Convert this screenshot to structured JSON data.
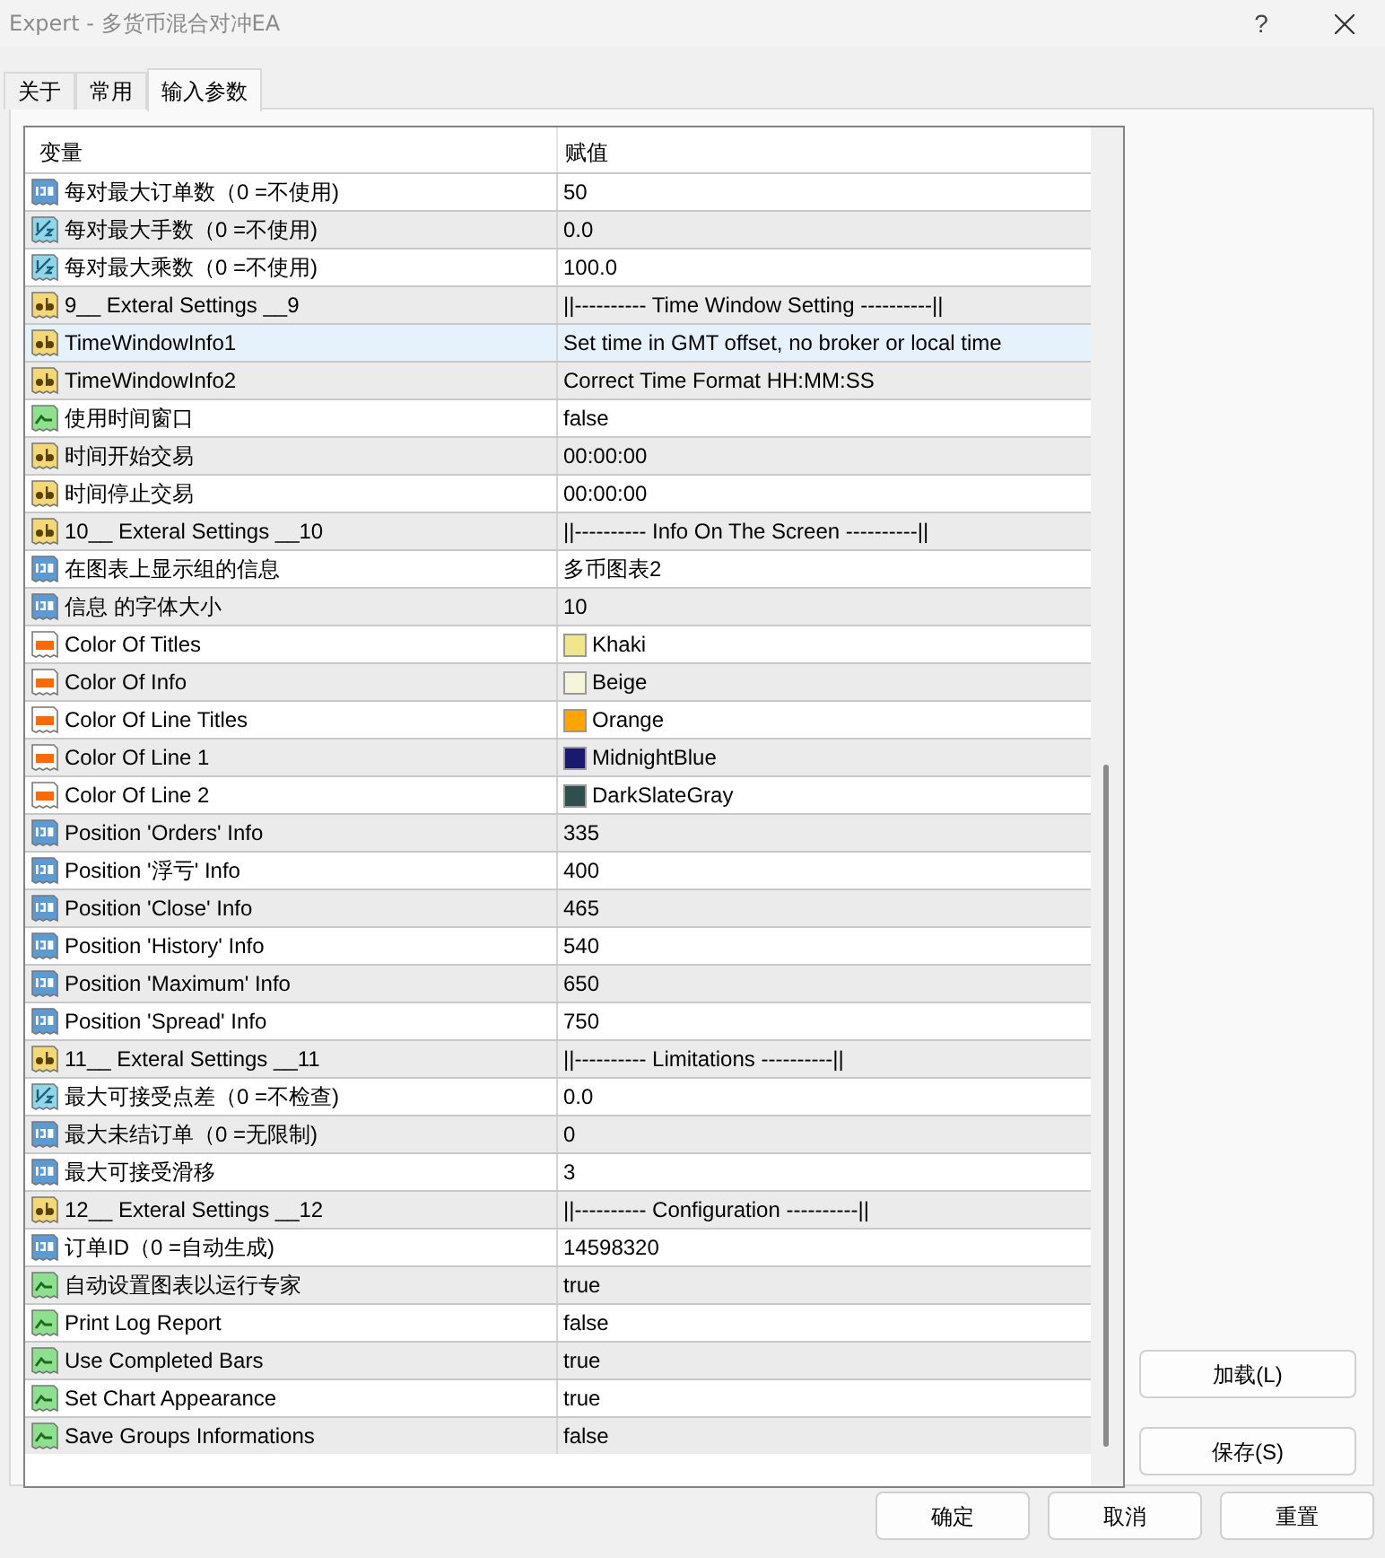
{
  "window": {
    "title": "Expert - 多货币混合对冲EA",
    "help": "?"
  },
  "tabs": [
    {
      "label": "关于",
      "selected": false
    },
    {
      "label": "常用",
      "selected": false
    },
    {
      "label": "输入参数",
      "selected": true
    }
  ],
  "table": {
    "columns": [
      "变量",
      "赋值"
    ],
    "rows": [
      {
        "kind": "int",
        "name": "每对最大订单数（0 =不使用)",
        "value": "50",
        "selected": false
      },
      {
        "kind": "double",
        "name": "每对最大手数（0 =不使用)",
        "value": "0.0",
        "selected": false
      },
      {
        "kind": "double",
        "name": "每对最大乘数（0 =不使用)",
        "value": "100.0",
        "selected": false
      },
      {
        "kind": "string",
        "name": "9__ Exteral Settings __9",
        "value": "||---------- Time Window Setting ----------||",
        "selected": false
      },
      {
        "kind": "string",
        "name": "TimeWindowInfo1",
        "value": "Set time in GMT offset, no broker or local time",
        "selected": true
      },
      {
        "kind": "string",
        "name": "TimeWindowInfo2",
        "value": "Correct Time Format HH:MM:SS",
        "selected": false
      },
      {
        "kind": "bool",
        "name": "使用时间窗口",
        "value": "false",
        "selected": false
      },
      {
        "kind": "string",
        "name": "时间开始交易",
        "value": "00:00:00",
        "selected": false
      },
      {
        "kind": "string",
        "name": "时间停止交易",
        "value": "00:00:00",
        "selected": false
      },
      {
        "kind": "string",
        "name": "10__ Exteral Settings __10",
        "value": "||---------- Info On The Screen ----------||",
        "selected": false
      },
      {
        "kind": "int",
        "name": "在图表上显示组的信息",
        "value": "多币图表2",
        "selected": false
      },
      {
        "kind": "int",
        "name": "信息 的字体大小",
        "value": "10",
        "selected": false
      },
      {
        "kind": "color",
        "name": "Color Of Titles",
        "value": "Khaki",
        "color": "#f0e68c",
        "selected": false
      },
      {
        "kind": "color",
        "name": "Color Of Info",
        "value": "Beige",
        "color": "#f5f5dc",
        "selected": false
      },
      {
        "kind": "color",
        "name": "Color Of Line Titles",
        "value": "Orange",
        "color": "#ffa500",
        "selected": false
      },
      {
        "kind": "color",
        "name": "Color Of Line 1",
        "value": "MidnightBlue",
        "color": "#191970",
        "selected": false
      },
      {
        "kind": "color",
        "name": "Color Of Line 2",
        "value": "DarkSlateGray",
        "color": "#2f4f4f",
        "selected": false
      },
      {
        "kind": "int",
        "name": "Position 'Orders' Info",
        "value": "335",
        "selected": false
      },
      {
        "kind": "int",
        "name": "Position '浮亏' Info",
        "value": "400",
        "selected": false
      },
      {
        "kind": "int",
        "name": "Position 'Close' Info",
        "value": "465",
        "selected": false
      },
      {
        "kind": "int",
        "name": "Position 'History' Info",
        "value": "540",
        "selected": false
      },
      {
        "kind": "int",
        "name": "Position 'Maximum' Info",
        "value": "650",
        "selected": false
      },
      {
        "kind": "int",
        "name": "Position 'Spread' Info",
        "value": "750",
        "selected": false
      },
      {
        "kind": "string",
        "name": "11__ Exteral Settings __11",
        "value": "||---------- Limitations ----------||",
        "selected": false
      },
      {
        "kind": "double",
        "name": "最大可接受点差（0 =不检查)",
        "value": "0.0",
        "selected": false
      },
      {
        "kind": "int",
        "name": "最大未结订单（0 =无限制)",
        "value": "0",
        "selected": false
      },
      {
        "kind": "int",
        "name": "最大可接受滑移",
        "value": "3",
        "selected": false
      },
      {
        "kind": "string",
        "name": "12__ Exteral Settings __12",
        "value": "||---------- Configuration ----------||",
        "selected": false
      },
      {
        "kind": "int",
        "name": "订单ID（0 =自动生成)",
        "value": "14598320",
        "selected": false
      },
      {
        "kind": "bool",
        "name": "自动设置图表以运行专家",
        "value": "true",
        "selected": false
      },
      {
        "kind": "bool",
        "name": "Print Log Report",
        "value": "false",
        "selected": false
      },
      {
        "kind": "bool",
        "name": "Use Completed Bars",
        "value": "true",
        "selected": false
      },
      {
        "kind": "bool",
        "name": "Set Chart Appearance",
        "value": "true",
        "selected": false
      },
      {
        "kind": "bool",
        "name": "Save Groups Informations",
        "value": "false",
        "selected": false
      }
    ]
  },
  "side_buttons": [
    "加载(L)",
    "保存(S)"
  ],
  "buttons": [
    "确定",
    "取消",
    "重置"
  ]
}
